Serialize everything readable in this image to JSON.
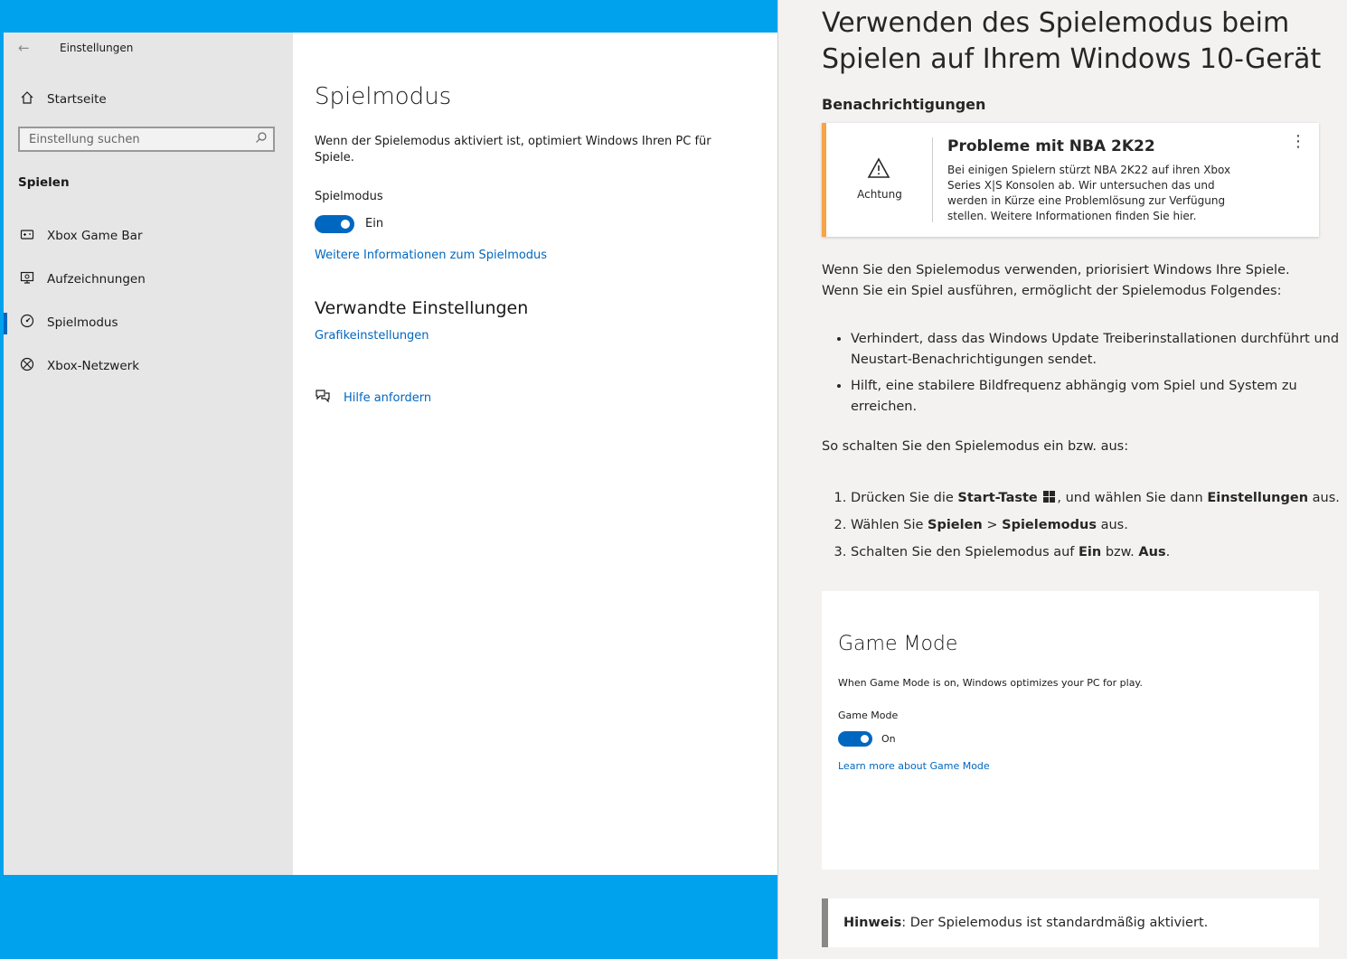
{
  "settings": {
    "window_title": "Einstellungen",
    "back_glyph": "←",
    "home_label": "Startseite",
    "search_placeholder": "Einstellung suchen",
    "section_heading": "Spielen",
    "nav_items": [
      {
        "label": "Xbox Game Bar",
        "icon": "xbox-game-bar-icon"
      },
      {
        "label": "Aufzeichnungen",
        "icon": "captures-icon"
      },
      {
        "label": "Spielmodus",
        "icon": "game-mode-icon",
        "active": true
      },
      {
        "label": "Xbox-Netzwerk",
        "icon": "xbox-icon"
      }
    ],
    "page_title": "Spielmodus",
    "description": "Wenn der Spielemodus aktiviert ist, optimiert Windows Ihren PC für Spiele.",
    "toggle_label": "Spielmodus",
    "toggle_state": "Ein",
    "more_info_link": "Weitere Informationen zum Spielmodus",
    "related_heading": "Verwandte Einstellungen",
    "graphics_link": "Grafikeinstellungen",
    "help_link": "Hilfe anfordern",
    "accent_color": "#0067c0"
  },
  "article": {
    "title": "Verwenden des Spielemodus beim Spielen auf Ihrem Windows 10-Gerät",
    "notifications_heading": "Benachrichtigungen",
    "alert": {
      "icon_label": "Achtung",
      "title": "Probleme mit NBA 2K22",
      "body": "Bei einigen Spielern stürzt NBA 2K22 auf ihren Xbox Series X|S Konsolen ab. Wir untersuchen das und werden in Kürze eine Problemlösung zur Verfügung stellen. Weitere Informationen finden Sie hier.",
      "more_glyph": "⋮",
      "stripe_color": "#f7a348"
    },
    "intro": "Wenn Sie den Spielemodus verwenden, priorisiert Windows Ihre Spiele. Wenn Sie ein Spiel ausführen, ermöglicht der Spielemodus Folgendes:",
    "bullets": [
      "Verhindert, dass das Windows Update Treiberinstallationen durchführt und Neustart-Benachrichtigungen sendet.",
      "Hilft, eine stabilere Bildfrequenz abhängig vom Spiel und System zu erreichen."
    ],
    "howto": "So schalten Sie den Spielemodus ein bzw. aus:",
    "steps": {
      "s1_pre": "Drücken Sie die ",
      "s1_bold1": "Start-Taste",
      "s1_mid": ", und wählen Sie dann ",
      "s1_bold2": "Einstellungen",
      "s1_post": " aus.",
      "s2_pre": "Wählen Sie ",
      "s2_bold1": "Spielen",
      "s2_mid": " > ",
      "s2_bold2": "Spielemodus",
      "s2_post": " aus.",
      "s3_pre": "Schalten Sie den Spielemodus auf ",
      "s3_bold1": "Ein",
      "s3_mid": " bzw. ",
      "s3_bold2": "Aus",
      "s3_post": "."
    },
    "screenshot": {
      "title": "Game Mode",
      "description": "When Game Mode is on, Windows optimizes your PC for play.",
      "toggle_label": "Game Mode",
      "toggle_state": "On",
      "link": "Learn more about Game Mode"
    },
    "note": {
      "bold": "Hinweis",
      "text": ": Der Spielemodus ist standardmäßig aktiviert."
    }
  }
}
